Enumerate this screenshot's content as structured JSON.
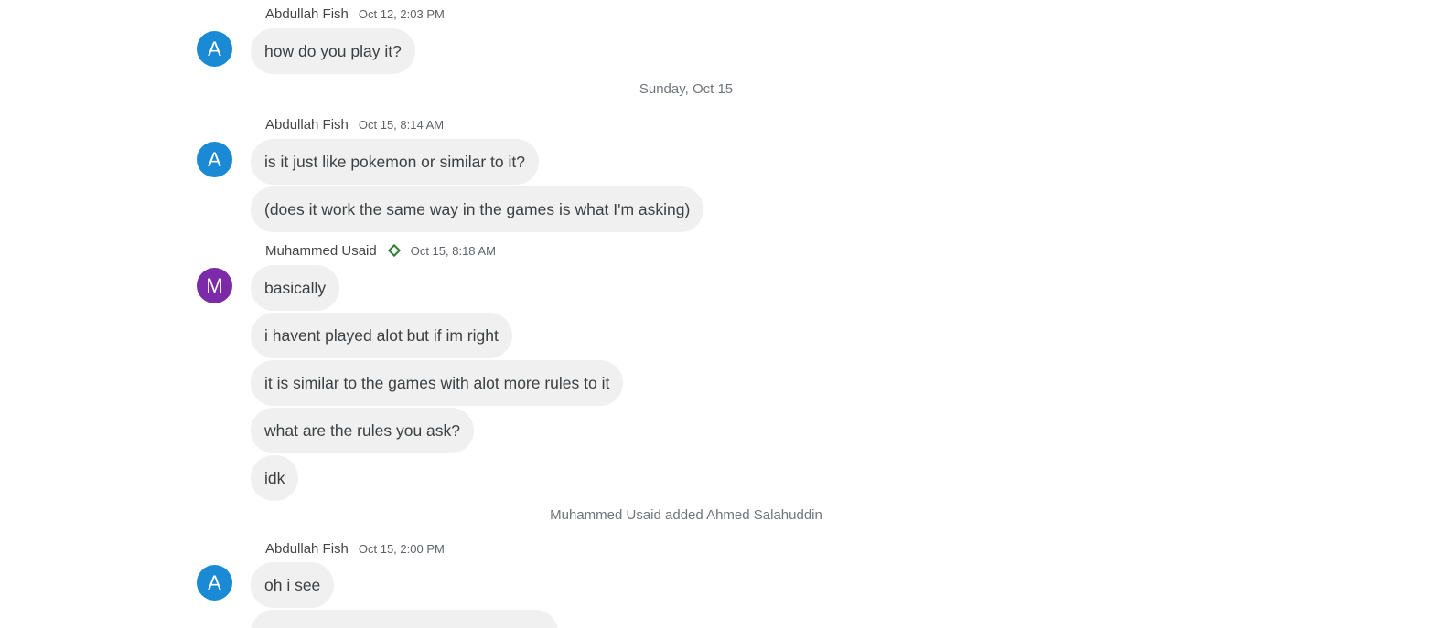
{
  "colors": {
    "avatar_blue": "#1a8ad4",
    "avatar_purple": "#7b2aa8",
    "bubble_bg": "#f0f0f0",
    "badge_green": "#2e7d32"
  },
  "messages": [
    {
      "sender": "Abdullah Fish",
      "time": "Oct 12, 2:03 PM",
      "avatar": "A",
      "lines": [
        "how do you play it?"
      ]
    },
    {
      "sender": "Abdullah Fish",
      "time": "Oct 15, 8:14 AM",
      "avatar": "A",
      "lines": [
        "is it just like pokemon or similar to it?",
        "(does it work the same way in the games is what I'm asking)"
      ]
    },
    {
      "sender": "Muhammed Usaid",
      "time": "Oct 15, 8:18 AM",
      "avatar": "M",
      "badge_icon": "diamond-outline-icon",
      "lines": [
        "basically",
        "i havent played alot but if im right",
        "it is similar to the games with alot more rules to it",
        "what are the rules you ask?",
        "idk"
      ]
    },
    {
      "sender": "Abdullah Fish",
      "time": "Oct 15, 2:00 PM",
      "avatar": "A",
      "lines": [
        "oh i see"
      ]
    }
  ],
  "dividers": {
    "date_sunday": "Sunday, Oct 15"
  },
  "system_events": {
    "added_member": "Muhammed Usaid added Ahmed Salahuddin"
  }
}
